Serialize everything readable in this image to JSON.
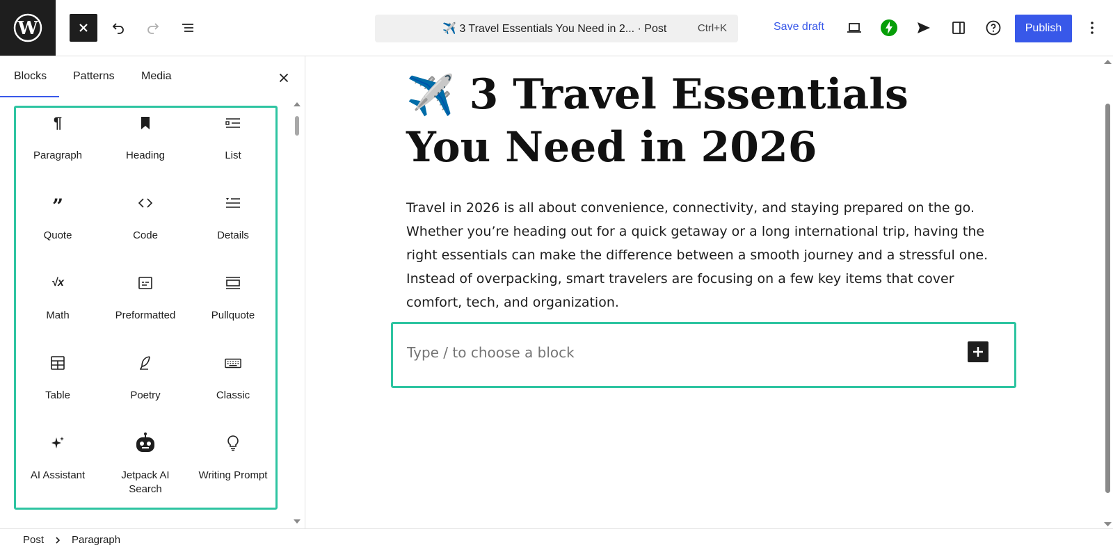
{
  "topbar": {
    "logo": "wordpress-logo",
    "close_label": "Close",
    "undo_label": "Undo",
    "redo_label": "Redo",
    "document_overview_label": "Document Overview",
    "command_title": "✈️ 3 Travel Essentials You Need in 2... · Post",
    "command_shortcut": "Ctrl+K",
    "save_draft": "Save draft",
    "publish": "Publish",
    "accent_color": "#3858e9"
  },
  "inserter": {
    "tabs": [
      "Blocks",
      "Patterns",
      "Media"
    ],
    "active_tab": "Blocks",
    "blocks": [
      {
        "label": "Paragraph",
        "icon": "paragraph-icon"
      },
      {
        "label": "Heading",
        "icon": "bookmark-icon"
      },
      {
        "label": "List",
        "icon": "list-icon"
      },
      {
        "label": "Quote",
        "icon": "quote-icon"
      },
      {
        "label": "Code",
        "icon": "code-icon"
      },
      {
        "label": "Details",
        "icon": "details-icon"
      },
      {
        "label": "Math",
        "icon": "math-icon"
      },
      {
        "label": "Preformatted",
        "icon": "preformatted-icon"
      },
      {
        "label": "Pullquote",
        "icon": "pullquote-icon"
      },
      {
        "label": "Table",
        "icon": "table-icon"
      },
      {
        "label": "Poetry",
        "icon": "feather-icon"
      },
      {
        "label": "Classic",
        "icon": "keyboard-icon"
      },
      {
        "label": "AI Assistant",
        "icon": "sparkles-icon"
      },
      {
        "label": "Jetpack AI Search",
        "icon": "robot-icon"
      },
      {
        "label": "Writing Prompt",
        "icon": "lightbulb-icon"
      }
    ],
    "highlight_color": "#2ec4a1"
  },
  "editor": {
    "title_emoji": "✈️",
    "title": "3 Travel Essentials You Need in 2026",
    "body": "Travel in 2026 is all about convenience, connectivity, and staying prepared on the go. Whether you’re heading out for a quick getaway or a long international trip, having the right essentials can make the difference between a smooth journey and a stressful one. Instead of overpacking, smart travelers are focusing on a few key items that cover comfort, tech, and organization.",
    "appender_placeholder": "Type / to choose a block"
  },
  "footer": {
    "breadcrumb": [
      "Post",
      "Paragraph"
    ]
  }
}
